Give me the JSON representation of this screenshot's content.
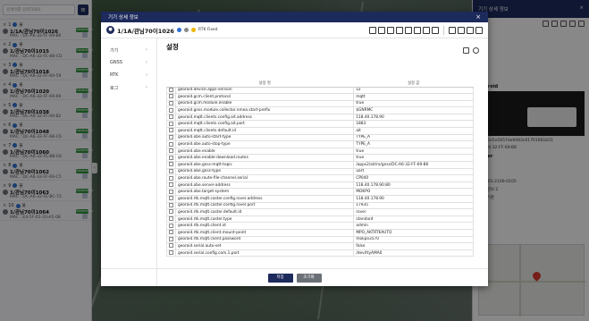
{
  "left_panel": {
    "search_placeholder": "검색어를 입력하세요",
    "devices": [
      {
        "num": "1",
        "status": "불",
        "name": "1/1A/관님70이1026",
        "mac": "MAC : DC-A6-32-FF-69-B6",
        "badge": "Generated"
      },
      {
        "num": "2",
        "status": "불",
        "name": "1/관님70이1015",
        "mac": "MAC : DC-A6-32-FE-88-CD",
        "badge": "Generated"
      },
      {
        "num": "3",
        "status": "불",
        "name": "1/관님70이1018",
        "mac": "MAC : DC-A6-32-FF-69-59",
        "badge": "Generated"
      },
      {
        "num": "4",
        "status": "불",
        "name": "1/관님70이1020",
        "mac": "MAC : DC-A6-32-FF-69-69",
        "badge": "Generated"
      },
      {
        "num": "5",
        "status": "불",
        "name": "1/관님70이1038",
        "mac": "MAC : DC-A6-32-FF-69-B2",
        "badge": "Generated"
      },
      {
        "num": "6",
        "status": "불",
        "name": "1/관님70이1048",
        "mac": "MAC : DC-A6-32-FF-6B-C6",
        "badge": "Generated"
      },
      {
        "num": "7",
        "status": "불",
        "name": "1/관님70이1060",
        "mac": "MAC : DC-A6-32-FE-BB-E8",
        "badge": "Generated"
      },
      {
        "num": "8",
        "status": "불",
        "name": "1/관님70이1062",
        "mac": "MAC : DC-A6-32-FF-69-C5",
        "badge": "Generated"
      },
      {
        "num": "9",
        "status": "불",
        "name": "1/관님70이1063",
        "mac": "MAC : DC-A6-32-FE-BC-72",
        "badge": "Generated"
      },
      {
        "num": "10",
        "status": "불",
        "name": "1/관님70이1064",
        "mac": "MAC : E4-5F-01-33-A5-08",
        "badge": "Generated"
      }
    ]
  },
  "right_panel": {
    "title": "기기 상세 정보",
    "close": "×",
    "section_label": "Georoid",
    "hash": "32ef5e5e5657de9493c61701061b51",
    "mac": "DC-A6-32-FF-69-B6",
    "power_label": "Rover",
    "power_value": "라우",
    "serial_label": "제조",
    "serial_value": "G03-01-2106-0105",
    "f1": "설치 정보 2",
    "f2": "관리 기준"
  },
  "modal": {
    "title": "기기 상세 정보",
    "close": "×",
    "device_name": "1/1A/관님70이1026",
    "rtk_status": "RTK Fixed",
    "nav": [
      {
        "label": "기기",
        "chev": "›"
      },
      {
        "label": "GNSS",
        "chev": "›"
      },
      {
        "label": "RTK",
        "chev": "›"
      },
      {
        "label": "로그",
        "chev": "›"
      }
    ],
    "section_title": "설정",
    "col_key": "설정 명",
    "col_val": "설정 값",
    "rows": [
      [
        "georoid.device.apps-version",
        "v2"
      ],
      [
        "georoid.gcm.client.protocol",
        "mqtt"
      ],
      [
        "georoid.gcm.module.enable",
        "true"
      ],
      [
        "georoid.gnss.module.collector.nmea.start-prefix",
        "$GNRMC"
      ],
      [
        "georoid.mqtt.clients.config.ait.address",
        "118.40.178.90"
      ],
      [
        "georoid.mqtt.clients.config.ait.port",
        "1883"
      ],
      [
        "georoid.mqtt.clients.default.id",
        "ait"
      ],
      [
        "georoid.obe.auto-start-type",
        "TYPE_A"
      ],
      [
        "georoid.obe.auto-stop-type",
        "TYPE_A"
      ],
      [
        "georoid.obe.enable",
        "true"
      ],
      [
        "georoid.obe.enable-download.routes",
        "true"
      ],
      [
        "georoid.obe.gnss-mqtt-topic",
        "/apps2/ait/rx/gnss/DC-A6-32-FF-69-B6"
      ],
      [
        "georoid.obe.gnss-type",
        "uart"
      ],
      [
        "georoid.obe.route-file-channel.serial",
        "CP040"
      ],
      [
        "georoid.obe.server-address",
        "118.40.178.90:80"
      ],
      [
        "georoid.obe.target-system",
        "MOKPO"
      ],
      [
        "georoid.rtk.mqtt.caster.config.rover.address",
        "118.40.178.90"
      ],
      [
        "georoid.rtk.mqtt.caster.config.rover.port",
        "17935"
      ],
      [
        "georoid.rtk.mqtt.caster.default.id",
        "rover"
      ],
      [
        "georoid.rtk.mqtt.caster.type",
        "standard"
      ],
      [
        "georoid.rtk.mqtt.client.id",
        "admin"
      ],
      [
        "georoid.rtk.mqtt.client.mount-point",
        "MPO_AKTRTKAUTO"
      ],
      [
        "georoid.rtk.mqtt.client.password",
        "mokpo3570"
      ],
      [
        "georoid.serial.auto-set",
        "false"
      ],
      [
        "georoid.serial.config.com.1.port",
        "/dev/ttyAMA0"
      ]
    ],
    "save_label": "저장",
    "reset_label": "초기화"
  },
  "colors": {
    "navy": "#1d2a5c",
    "badge_green": "#2f8e3c",
    "accent_blue": "#2e6fcc"
  }
}
